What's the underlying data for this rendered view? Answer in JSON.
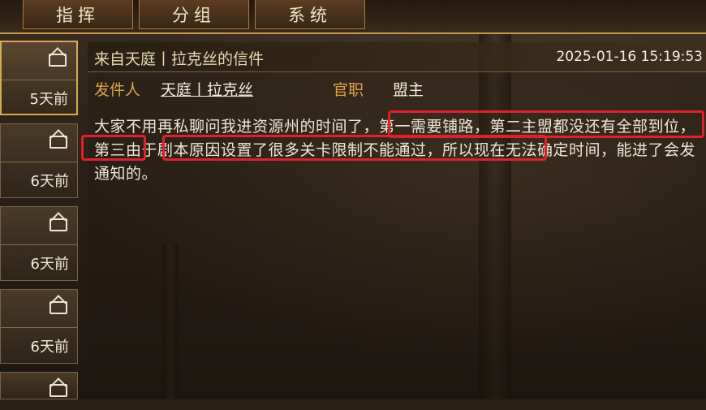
{
  "tabs": [
    "指挥",
    "分组",
    "系统"
  ],
  "mail_list": [
    {
      "age": "5天前",
      "active": true
    },
    {
      "age": "6天前",
      "active": false
    },
    {
      "age": "6天前",
      "active": false
    },
    {
      "age": "6天前",
      "active": false
    },
    {
      "age": "",
      "active": false
    }
  ],
  "mail": {
    "subject": "来自天庭丨拉克丝的信件",
    "date": "2025-01-16 15:19:53",
    "sender_label": "发件人",
    "sender_name": "天庭丨拉克丝",
    "rank_label": "官职",
    "rank_value": "盟主",
    "body": "大家不用再私聊问我进资源州的时间了，第一需要铺路，第二主盟都没还有全部到位，第三由于剧本原因设置了很多关卡限制不能通过，所以现在无法确定时间，能进了会发通知的。"
  },
  "colors": {
    "accent_gold": "#d9a54a",
    "highlight_red": "#e0202a"
  }
}
